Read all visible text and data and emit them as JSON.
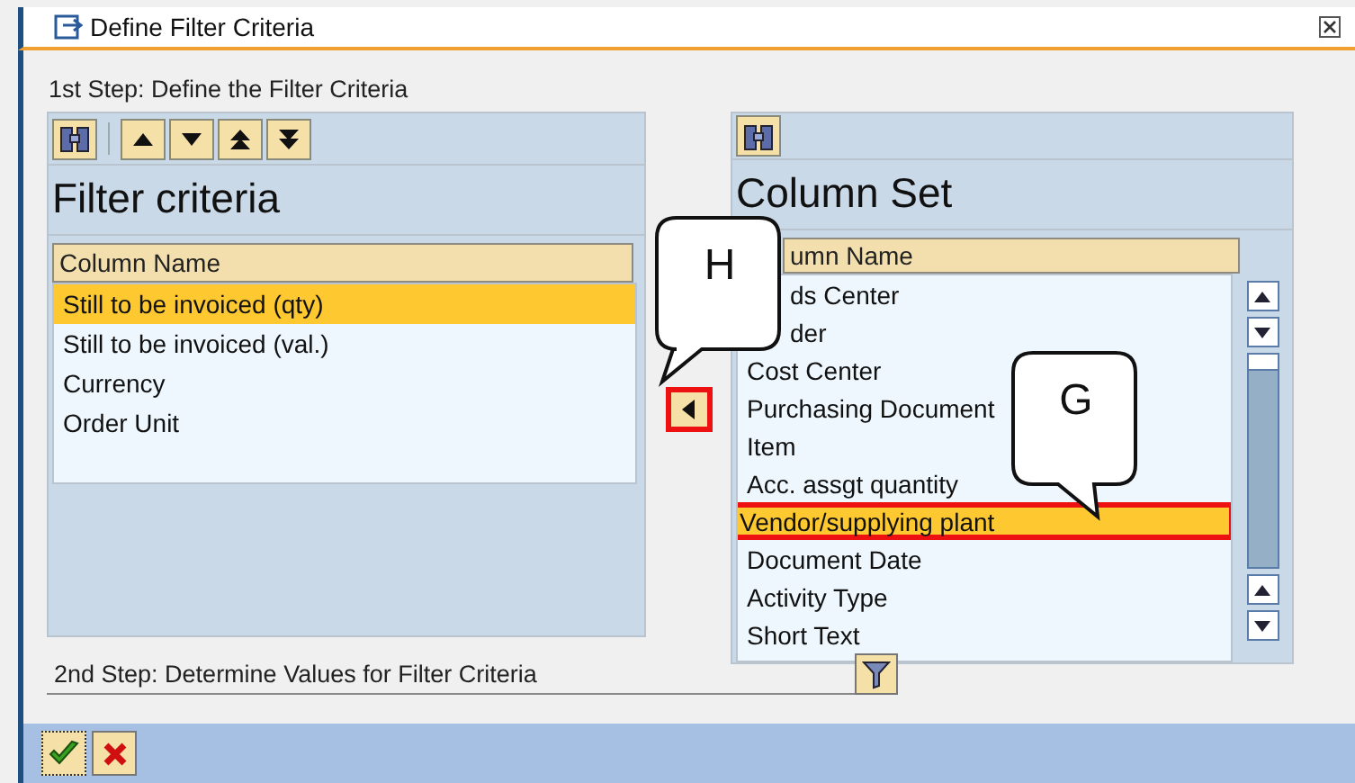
{
  "window": {
    "title": "Define Filter Criteria"
  },
  "step1": "1st Step: Define the Filter Criteria",
  "filter_criteria": {
    "title": "Filter criteria",
    "column_header": "Column Name",
    "rows": [
      {
        "label": "Still to be invoiced (qty)",
        "selected": true
      },
      {
        "label": "Still to be invoiced (val.)",
        "selected": false
      },
      {
        "label": "Currency",
        "selected": false
      },
      {
        "label": "Order Unit",
        "selected": false
      }
    ]
  },
  "move_left_button": {
    "highlighted": true
  },
  "column_set": {
    "title": "Column Set",
    "column_header": "umn Name",
    "rows": [
      {
        "label": "ds Center",
        "selected": false,
        "highlighted": false,
        "covered": true
      },
      {
        "label": "der",
        "selected": false,
        "highlighted": false,
        "covered": true
      },
      {
        "label": "Cost Center",
        "selected": false,
        "highlighted": false,
        "covered": false
      },
      {
        "label": "Purchasing Document",
        "selected": false,
        "highlighted": false,
        "covered": false
      },
      {
        "label": "Item",
        "selected": false,
        "highlighted": false,
        "covered": false
      },
      {
        "label": "Acc. assgt quantity",
        "selected": false,
        "highlighted": false,
        "covered": false
      },
      {
        "label": "Vendor/supplying plant",
        "selected": true,
        "highlighted": true,
        "covered": false
      },
      {
        "label": "Document Date",
        "selected": false,
        "highlighted": false,
        "covered": false
      },
      {
        "label": "Activity Type",
        "selected": false,
        "highlighted": false,
        "covered": false
      },
      {
        "label": "Short Text",
        "selected": false,
        "highlighted": false,
        "covered": false
      }
    ]
  },
  "step2": "2nd Step: Determine Values for Filter Criteria",
  "callouts": [
    {
      "label": "H"
    },
    {
      "label": "G"
    }
  ]
}
